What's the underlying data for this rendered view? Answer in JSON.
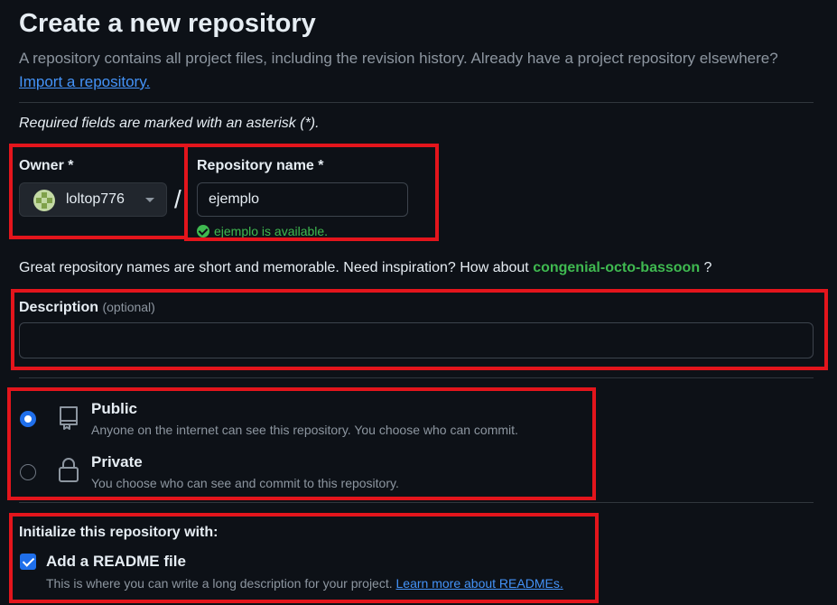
{
  "header": {
    "title": "Create a new repository",
    "subtitle": "A repository contains all project files, including the revision history. Already have a project repository elsewhere?",
    "import_link": "Import a repository."
  },
  "required_note": "Required fields are marked with an asterisk (*).",
  "owner": {
    "label": "Owner *",
    "value": "loltop776"
  },
  "separator": "/",
  "repository_name": {
    "label": "Repository name *",
    "value": "ejemplo",
    "availability": "ejemplo is available."
  },
  "suggestion": {
    "text": "Great repository names are short and memorable. Need inspiration? How about",
    "name": "congenial-octo-bassoon",
    "suffix": "?"
  },
  "description": {
    "label": "Description",
    "optional": "(optional)",
    "value": ""
  },
  "visibility": {
    "options": [
      {
        "label": "Public",
        "description": "Anyone on the internet can see this repository. You choose who can commit.",
        "selected": true,
        "icon": "repo-icon"
      },
      {
        "label": "Private",
        "description": "You choose who can see and commit to this repository.",
        "selected": false,
        "icon": "lock-icon"
      }
    ]
  },
  "initialize": {
    "title": "Initialize this repository with:",
    "readme": {
      "label": "Add a README file",
      "checked": true,
      "description": "This is where you can write a long description for your project.",
      "link": "Learn more about READMEs."
    }
  },
  "colors": {
    "background": "#0d1117",
    "accent": "#1f6feb",
    "link": "#4493f8",
    "success": "#3fb950",
    "highlight_box": "#e3151c"
  }
}
